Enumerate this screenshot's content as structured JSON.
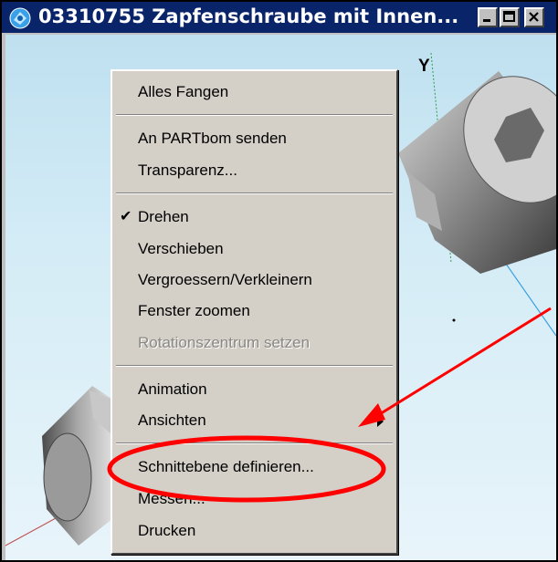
{
  "window": {
    "title": "03310755 Zapfenschraube mit Innen..."
  },
  "viewport": {
    "axis_label": "Y"
  },
  "menu": {
    "items": [
      {
        "label": "Alles Fangen"
      },
      {
        "label": "An PARTbom senden"
      },
      {
        "label": "Transparenz..."
      },
      {
        "label": "Drehen",
        "checked": true
      },
      {
        "label": "Verschieben"
      },
      {
        "label": "Vergroessern/Verkleinern"
      },
      {
        "label": "Fenster zoomen"
      },
      {
        "label": "Rotationszentrum setzen",
        "disabled": true
      },
      {
        "label": "Animation"
      },
      {
        "label": "Ansichten",
        "submenu": true
      },
      {
        "label": "Schnittebene definieren...",
        "highlighted_annotation": true
      },
      {
        "label": "Messen..."
      },
      {
        "label": "Drucken"
      }
    ]
  },
  "annotation": {
    "color": "#ff0000"
  }
}
